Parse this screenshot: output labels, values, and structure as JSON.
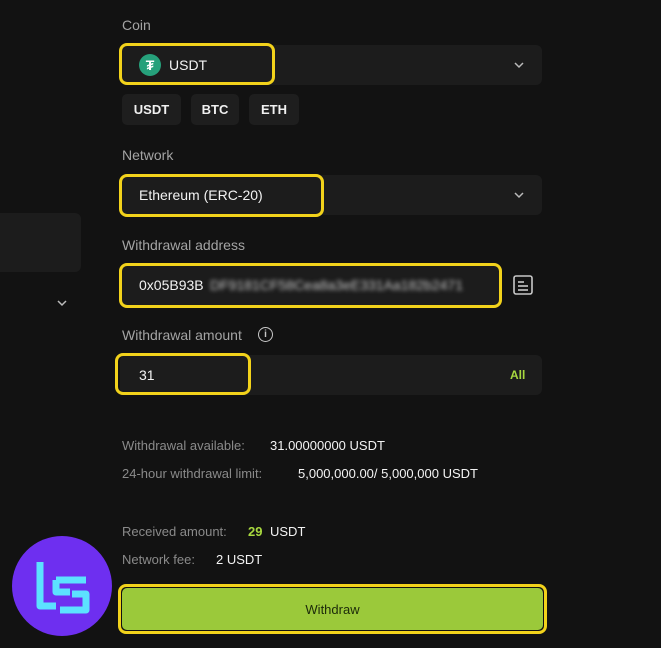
{
  "coin": {
    "label": "Coin",
    "selected": "USDT",
    "token_symbol": "₮",
    "quick_picks": [
      "USDT",
      "BTC",
      "ETH"
    ]
  },
  "network": {
    "label": "Network",
    "selected": "Ethereum (ERC-20)"
  },
  "address": {
    "label": "Withdrawal address",
    "visible_prefix": "0x05B93B",
    "blurred_rest": "DF9181CF58Cea8a3eE331Aa182b2471"
  },
  "amount": {
    "label": "Withdrawal amount",
    "info_icon": "i",
    "value": "31",
    "all_label": "All"
  },
  "info": {
    "available_label": "Withdrawal available:",
    "available_value": "31.00000000 USDT",
    "limit_label": "24-hour withdrawal limit:",
    "limit_value": "5,000,000.00/ 5,000,000 USDT"
  },
  "summary": {
    "received_label": "Received amount:",
    "received_value": "29",
    "received_unit": "USDT",
    "fee_label": "Network fee:",
    "fee_value": "2 USDT"
  },
  "withdraw_button": "Withdraw",
  "colors": {
    "highlight": "#f2d21b",
    "accent_green": "#a8d83f",
    "button_bg": "#9bc93a",
    "tether": "#26a17b",
    "logo_bg": "#6e2ff0"
  }
}
